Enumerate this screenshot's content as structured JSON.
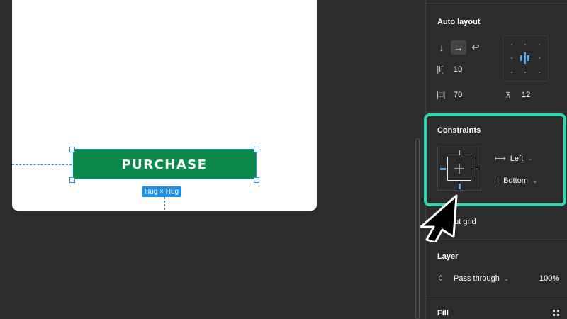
{
  "canvas": {
    "button_label": "PURCHASE",
    "size_badge": "Hug × Hug"
  },
  "panel": {
    "auto_layout": {
      "title": "Auto layout",
      "direction_icons": [
        "arrow-down-icon",
        "arrow-right-icon",
        "wrap-icon"
      ],
      "spacing_value": "10",
      "padding_h_value": "70",
      "padding_v_value": "12"
    },
    "constraints": {
      "title": "Constraints",
      "horizontal": "Left",
      "vertical": "Bottom"
    },
    "layout_grid": {
      "title": "Layout grid",
      "visible_text": "out grid"
    },
    "layer": {
      "title": "Layer",
      "blend_mode": "Pass through",
      "opacity": "100%"
    },
    "fill": {
      "title": "Fill"
    }
  },
  "colors": {
    "accent_highlight": "#2fd8b3",
    "button_green": "#0b8a4b",
    "selection_blue": "#1e8fe6"
  }
}
